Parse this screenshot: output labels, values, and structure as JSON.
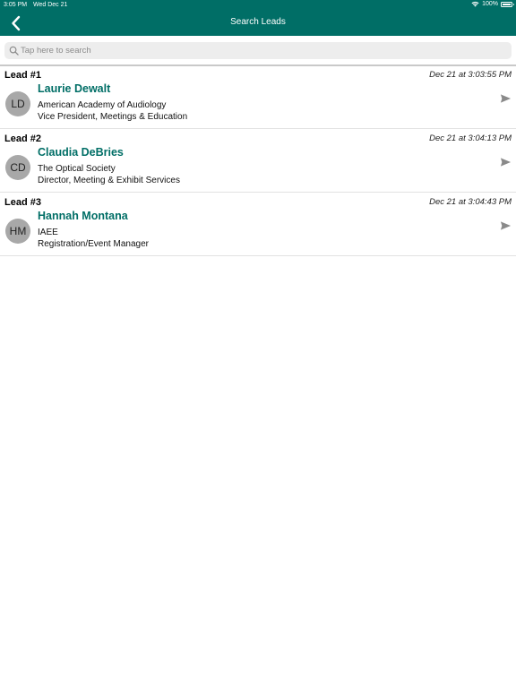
{
  "status_bar": {
    "time": "3:05 PM",
    "date": "Wed Dec 21",
    "battery": "100%",
    "wifi_icon": "wifi-icon",
    "battery_icon": "battery-icon"
  },
  "nav": {
    "title": "Search Leads",
    "back_icon": "chevron-left-icon"
  },
  "search": {
    "placeholder": "Tap here to search",
    "value": "",
    "icon": "search-icon"
  },
  "leads": [
    {
      "number": "Lead #1",
      "timestamp": "Dec 21 at 3:03:55 PM",
      "initials": "LD",
      "name": "Laurie Dewalt",
      "organization": "American Academy of Audiology",
      "title": "Vice President, Meetings & Education"
    },
    {
      "number": "Lead #2",
      "timestamp": "Dec 21 at 3:04:13 PM",
      "initials": "CD",
      "name": "Claudia DeBries",
      "organization": "The Optical Society",
      "title": "Director, Meeting & Exhibit Services"
    },
    {
      "number": "Lead #3",
      "timestamp": "Dec 21 at 3:04:43 PM",
      "initials": "HM",
      "name": "Hannah Montana",
      "organization": "IAEE",
      "title": "Registration/Event Manager"
    }
  ],
  "colors": {
    "brand": "#006e66",
    "avatar": "#a8a8a8",
    "send_icon": "#8a8a8a"
  },
  "send_icon": "send-icon"
}
